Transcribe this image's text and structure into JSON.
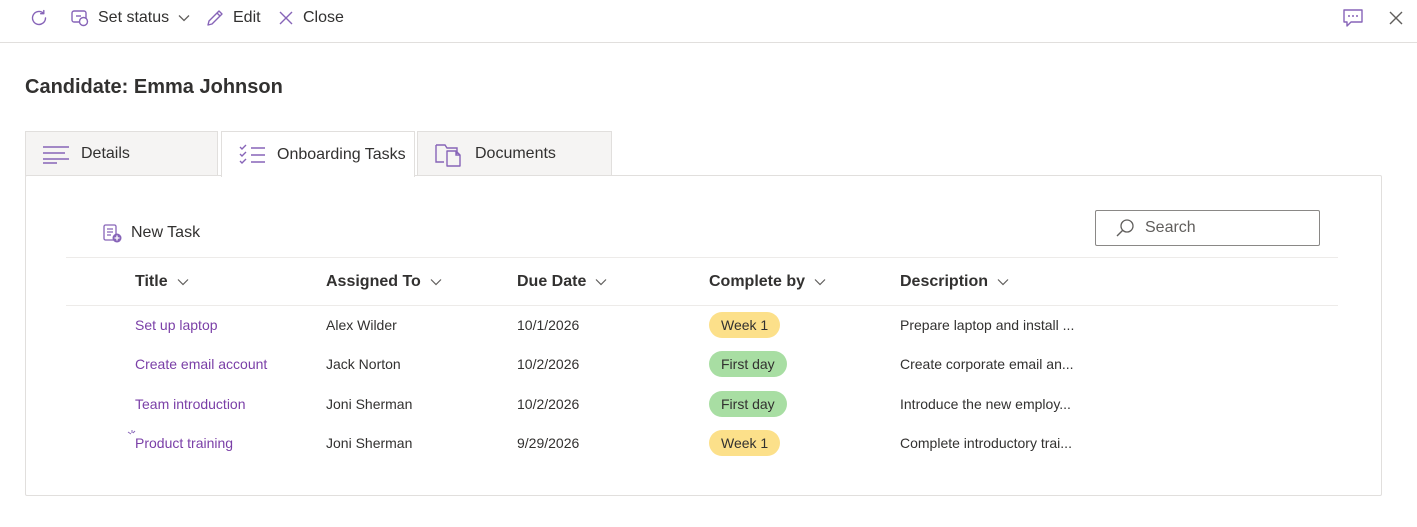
{
  "toolbar": {
    "set_status_label": "Set status",
    "edit_label": "Edit",
    "close_label": "Close"
  },
  "page": {
    "title": "Candidate: Emma Johnson"
  },
  "tabs": [
    {
      "label": "Details"
    },
    {
      "label": "Onboarding Tasks",
      "selected": true
    },
    {
      "label": "Documents"
    }
  ],
  "list": {
    "new_task_label": "New Task",
    "search_placeholder": "Search",
    "columns": [
      "Title",
      "Assigned To",
      "Due Date",
      "Complete by",
      "Description"
    ],
    "rows": [
      {
        "title": "Set up laptop",
        "assigned_to": "Alex Wilder",
        "due_date": "10/1/2026",
        "complete_by": "Week 1",
        "complete_by_color": "#fce08a",
        "description": "Prepare laptop and install ..."
      },
      {
        "title": "Create email account",
        "assigned_to": "Jack Norton",
        "due_date": "10/2/2026",
        "complete_by": "First day",
        "complete_by_color": "#a8dea3",
        "description": "Create corporate email an..."
      },
      {
        "title": "Team introduction",
        "assigned_to": "Joni Sherman",
        "due_date": "10/2/2026",
        "complete_by": "First day",
        "complete_by_color": "#a8dea3",
        "description": "Introduce the new employ..."
      },
      {
        "title": "Product training",
        "assigned_to": "Joni Sherman",
        "due_date": "9/29/2026",
        "complete_by": "Week 1",
        "complete_by_color": "#fce08a",
        "description": "Complete introductory trai..."
      }
    ]
  },
  "colors": {
    "accent": "#7a3fa7",
    "icon": "#8764b8"
  }
}
